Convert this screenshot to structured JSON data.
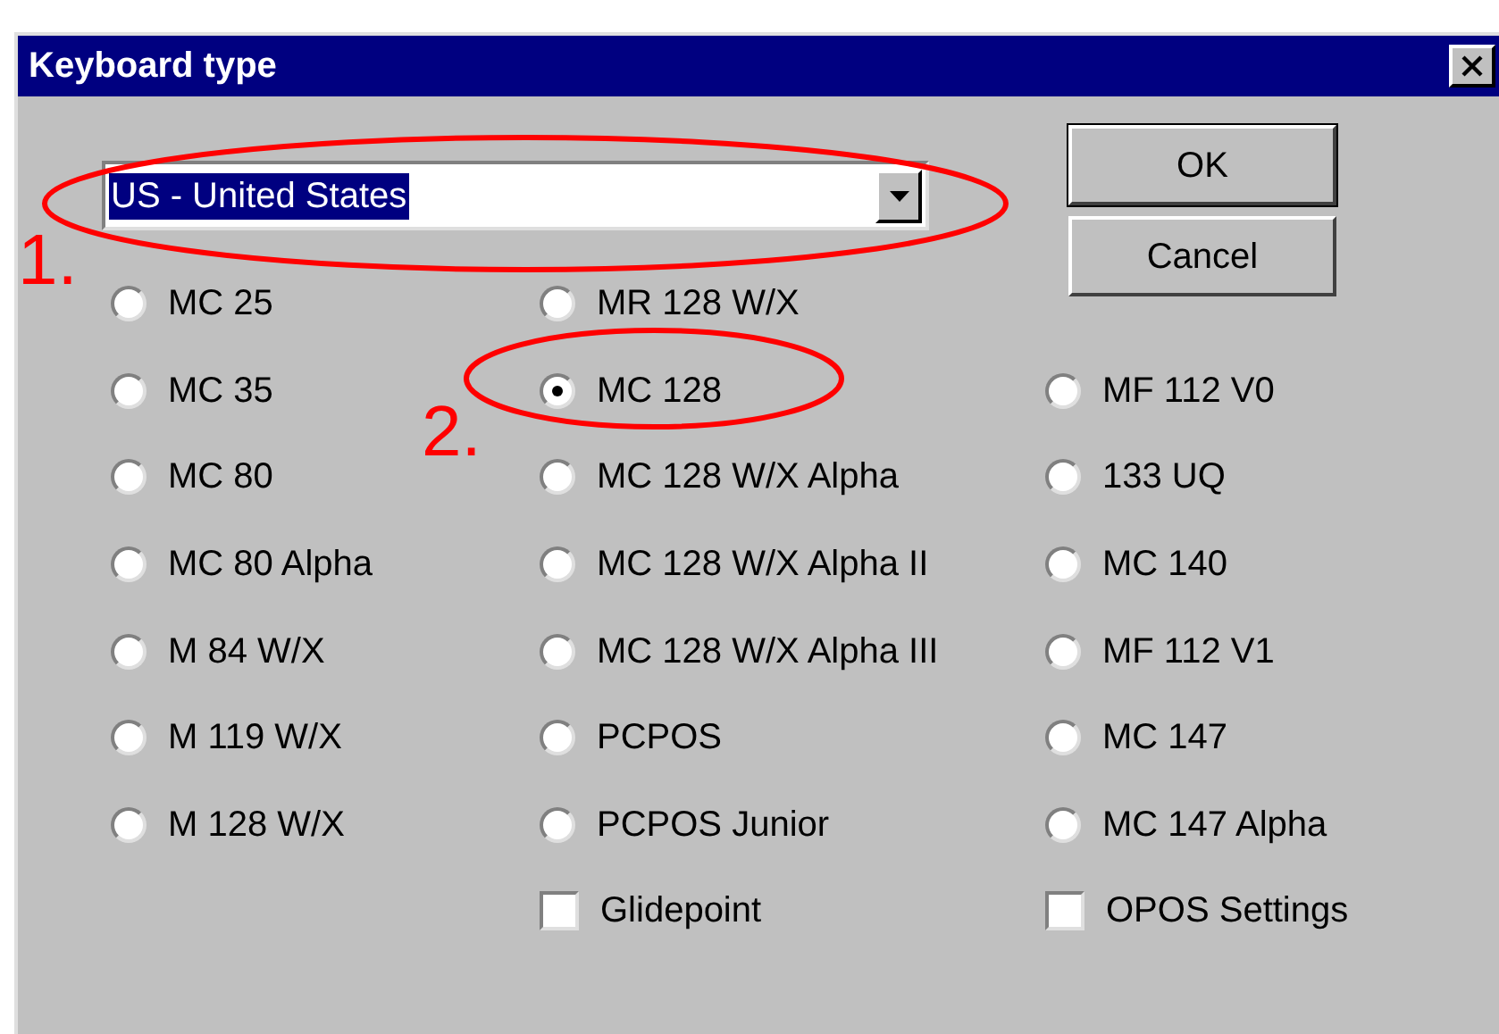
{
  "window": {
    "title": "Keyboard type"
  },
  "keyboard_select": {
    "value": "US - United States"
  },
  "buttons": [
    "OK",
    "Cancel"
  ],
  "layout_columns": [
    {
      "items": [
        {
          "label": "MC 25",
          "selected": false
        },
        {
          "label": "MC 35",
          "selected": false
        },
        {
          "label": "MC 80",
          "selected": false
        },
        {
          "label": "MC 80 Alpha",
          "selected": false
        },
        {
          "label": "M 84 W/X",
          "selected": false
        },
        {
          "label": "M 119 W/X",
          "selected": false
        },
        {
          "label": "M 128 W/X",
          "selected": false
        }
      ]
    },
    {
      "items": [
        {
          "label": "MR 128 W/X",
          "selected": false
        },
        {
          "label": "MC 128",
          "selected": true
        },
        {
          "label": "MC 128 W/X Alpha",
          "selected": false
        },
        {
          "label": "MC 128 W/X Alpha II",
          "selected": false
        },
        {
          "label": "MC 128 W/X Alpha III",
          "selected": false
        },
        {
          "label": "PCPOS",
          "selected": false
        },
        {
          "label": "PCPOS Junior",
          "selected": false
        }
      ]
    },
    {
      "items": [
        {
          "label": "MF 112 V0",
          "selected": false
        },
        {
          "label": "133 UQ",
          "selected": false
        },
        {
          "label": "MC 140",
          "selected": false
        },
        {
          "label": "MF 112 V1",
          "selected": false
        },
        {
          "label": "MC 147",
          "selected": false
        },
        {
          "label": "MC 147 Alpha",
          "selected": false
        }
      ]
    }
  ],
  "options": [
    {
      "label": "Glidepoint",
      "checked": false
    },
    {
      "label": "OPOS Settings",
      "checked": false
    }
  ],
  "annotations": [
    {
      "label": "1."
    },
    {
      "label": "2."
    }
  ]
}
